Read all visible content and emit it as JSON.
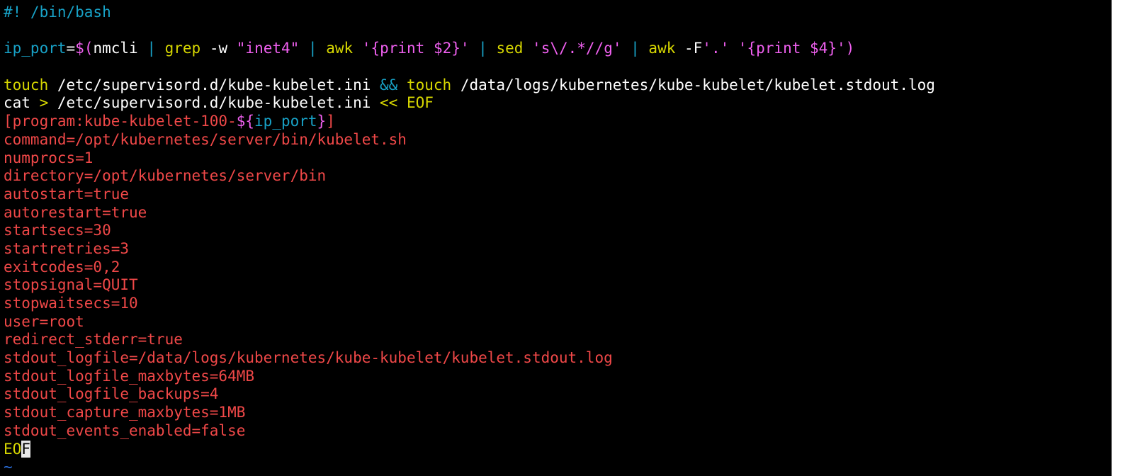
{
  "terminal": {
    "lines": [
      [
        {
          "t": "#! /bin/bash",
          "c": "comment"
        }
      ],
      [],
      [
        {
          "t": "ip_port",
          "c": "var"
        },
        {
          "t": "=",
          "c": "plain"
        },
        {
          "t": "$(",
          "c": "paren"
        },
        {
          "t": "nmcli ",
          "c": "plain"
        },
        {
          "t": "|",
          "c": "op"
        },
        {
          "t": " grep ",
          "c": "cmd"
        },
        {
          "t": "-w ",
          "c": "plain"
        },
        {
          "t": "\"inet4\"",
          "c": "str"
        },
        {
          "t": " | ",
          "c": "op"
        },
        {
          "t": "awk ",
          "c": "cmd"
        },
        {
          "t": "'{print $2}'",
          "c": "str"
        },
        {
          "t": " | ",
          "c": "op"
        },
        {
          "t": "sed ",
          "c": "cmd"
        },
        {
          "t": "'s\\/.*//g'",
          "c": "str"
        },
        {
          "t": " | ",
          "c": "op"
        },
        {
          "t": "awk ",
          "c": "cmd"
        },
        {
          "t": "-F",
          "c": "plain"
        },
        {
          "t": "'.'",
          "c": "str"
        },
        {
          "t": " ",
          "c": "plain"
        },
        {
          "t": "'{print $4}'",
          "c": "str"
        },
        {
          "t": ")",
          "c": "paren"
        }
      ],
      [],
      [
        {
          "t": "touch",
          "c": "cmd"
        },
        {
          "t": " /etc/supervisord.d/kube-kubelet.ini ",
          "c": "plain"
        },
        {
          "t": "&&",
          "c": "op"
        },
        {
          "t": " touch",
          "c": "cmd"
        },
        {
          "t": " /data/logs/kubernetes/kube-kubelet/kubelet.stdout.log",
          "c": "plain"
        }
      ],
      [
        {
          "t": "cat ",
          "c": "plain"
        },
        {
          "t": ">",
          "c": "opy"
        },
        {
          "t": " /etc/supervisord.d/kube-kubelet.ini ",
          "c": "plain"
        },
        {
          "t": "<< EOF",
          "c": "opy"
        }
      ],
      [
        {
          "t": "[program:kube-kubelet-100-",
          "c": "here"
        },
        {
          "t": "${",
          "c": "paren"
        },
        {
          "t": "ip_port",
          "c": "var"
        },
        {
          "t": "}",
          "c": "paren"
        },
        {
          "t": "]",
          "c": "here"
        }
      ],
      [
        {
          "t": "command=/opt/kubernetes/server/bin/kubelet.sh",
          "c": "here"
        }
      ],
      [
        {
          "t": "numprocs=1",
          "c": "here"
        }
      ],
      [
        {
          "t": "directory=/opt/kubernetes/server/bin",
          "c": "here"
        }
      ],
      [
        {
          "t": "autostart=true",
          "c": "here"
        }
      ],
      [
        {
          "t": "autorestart=true",
          "c": "here"
        }
      ],
      [
        {
          "t": "startsecs=30",
          "c": "here"
        }
      ],
      [
        {
          "t": "startretries=3",
          "c": "here"
        }
      ],
      [
        {
          "t": "exitcodes=0,2",
          "c": "here"
        }
      ],
      [
        {
          "t": "stopsignal=QUIT",
          "c": "here"
        }
      ],
      [
        {
          "t": "stopwaitsecs=10",
          "c": "here"
        }
      ],
      [
        {
          "t": "user=root",
          "c": "here"
        }
      ],
      [
        {
          "t": "redirect_stderr=true",
          "c": "here"
        }
      ],
      [
        {
          "t": "stdout_logfile=/data/logs/kubernetes/kube-kubelet/kubelet.stdout.log",
          "c": "here"
        }
      ],
      [
        {
          "t": "stdout_logfile_maxbytes=64MB",
          "c": "here"
        }
      ],
      [
        {
          "t": "stdout_logfile_backups=4",
          "c": "here"
        }
      ],
      [
        {
          "t": "stdout_capture_maxbytes=1MB",
          "c": "here"
        }
      ],
      [
        {
          "t": "stdout_events_enabled=false",
          "c": "here"
        }
      ],
      [
        {
          "t": "EO",
          "c": "eof"
        },
        {
          "t": "F",
          "c": "eof",
          "cursor": true
        }
      ],
      [
        {
          "t": "~",
          "c": "tilde"
        }
      ]
    ]
  },
  "colors": {
    "background": "#000000",
    "comment": "#18a2c7",
    "command": "#d7d700",
    "string": "#f060f0",
    "heredoc": "#f04848",
    "plain": "#ffffff",
    "tilde": "#2a6fdd",
    "cursor": "#e8e8e8"
  }
}
